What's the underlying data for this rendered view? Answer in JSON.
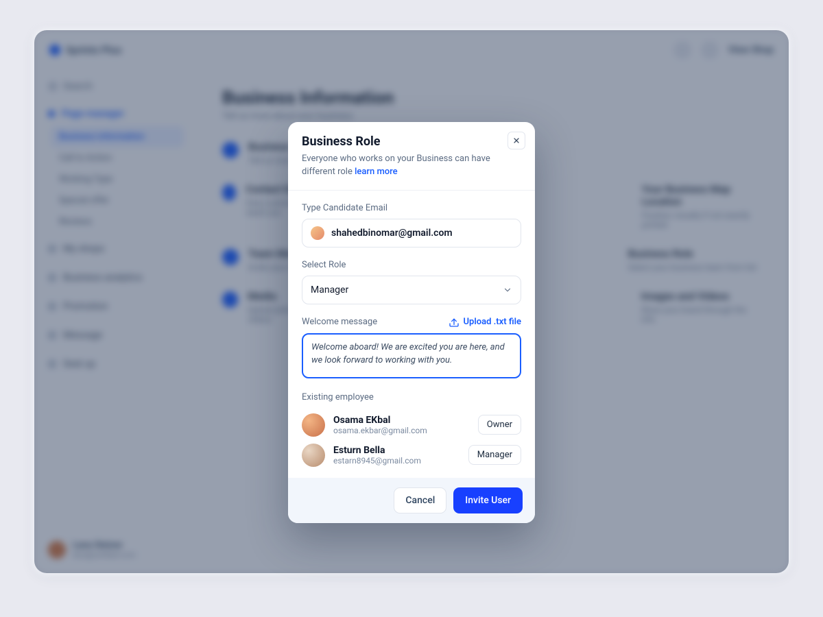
{
  "app": {
    "brand": "Sprints Plus",
    "view_shop": "View Shop",
    "search_placeholder": "Search"
  },
  "sidebar": {
    "active_group": "Page manager",
    "items": [
      {
        "label": "Business information"
      },
      {
        "label": "Call to Action"
      },
      {
        "label": "Working Type"
      },
      {
        "label": "Special offer"
      },
      {
        "label": "Reviews"
      }
    ],
    "groups": [
      {
        "label": "My shops"
      },
      {
        "label": "Business analytics"
      },
      {
        "label": "Promotion"
      },
      {
        "label": "Message"
      },
      {
        "label": "Seat up"
      }
    ],
    "profile": {
      "name": "Lana Steiner",
      "email": "lana@untitled.com"
    }
  },
  "main": {
    "title": "Business Information",
    "subtitle": "Tell us more about your business",
    "cards": [
      {
        "left_title": "Business Information",
        "left_sub": "Tell us more about your business",
        "right_title": "",
        "right_sub": ""
      },
      {
        "left_title": "Contact Details",
        "left_sub": "How customers can reach you",
        "right_title": "Your Business Map Location",
        "right_sub": "Position visually if not exactly printed"
      },
      {
        "left_title": "Team Members",
        "left_sub": "Invite your coworkers",
        "right_title": "Business Role",
        "right_sub": "Select your business team from list"
      },
      {
        "left_title": "Media",
        "left_sub": "Upload photos and videos",
        "right_title": "Images and Videos",
        "right_sub": "Show your brand through the info"
      }
    ]
  },
  "modal": {
    "title": "Business Role",
    "description": "Everyone who works on your Business can have different role",
    "learn_more": "learn more",
    "email_label": "Type Candidate Email",
    "email_value": "shahedbinomar@gmail.com",
    "role_label": "Select Role",
    "role_value": "Manager",
    "welcome_label": "Welcome message",
    "upload_label": "Upload .txt file",
    "welcome_value": "Welcome aboard! We are excited you are here, and we look forward to working with you.",
    "existing_label": "Existing employee",
    "employees": [
      {
        "name": "Osama EKbal",
        "email": "osama.ekbar@gmail.com",
        "role": "Owner"
      },
      {
        "name": "Esturn Bella",
        "email": "estarn8945@gmail.com",
        "role": "Manager"
      }
    ],
    "cancel": "Cancel",
    "invite": "Invite User"
  }
}
